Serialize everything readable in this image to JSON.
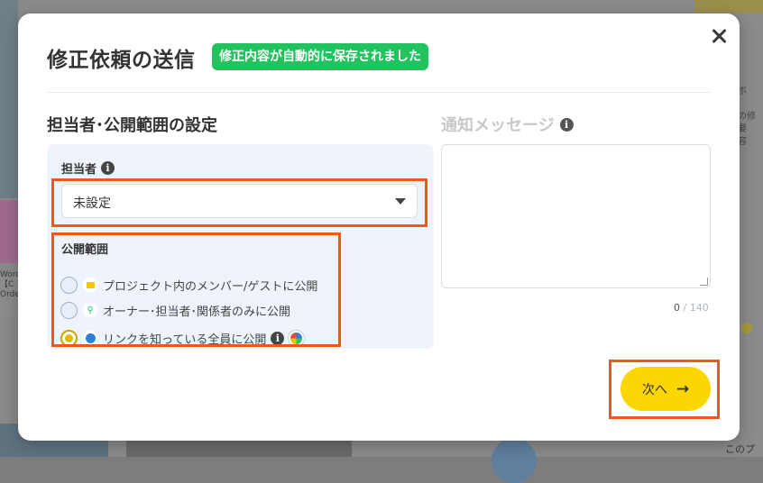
{
  "background": {
    "left_text": "Word\n【C\nOrde",
    "right_text": "頼ボ\n\n・の修\n・要\n・容",
    "right_footer": "このプ"
  },
  "modal": {
    "title": "修正依頼の送信",
    "saved_badge": "修正内容が自動的に保存されました",
    "close_icon": "close-icon"
  },
  "assignment": {
    "section_title": "担当者･公開範囲の設定",
    "assignee_label": "担当者",
    "assignee_value": "未設定",
    "scope_label": "公開範囲",
    "options": [
      {
        "label": "プロジェクト内のメンバー/ゲストに公開",
        "icon": "folder-icon",
        "selected": false
      },
      {
        "label": "オーナー･担当者･関係者のみに公開",
        "icon": "key-icon",
        "selected": false
      },
      {
        "label": "リンクを知っている全員に公開",
        "icon": "globe-icon",
        "selected": true
      }
    ]
  },
  "message": {
    "title": "通知メッセージ",
    "count": "0",
    "max": "140"
  },
  "actions": {
    "next_label": "次へ"
  },
  "colors": {
    "accent_yellow": "#fbd600",
    "badge_green": "#22c35e",
    "highlight_orange": "#ee5a14",
    "panel_bg": "#eff4fc"
  }
}
